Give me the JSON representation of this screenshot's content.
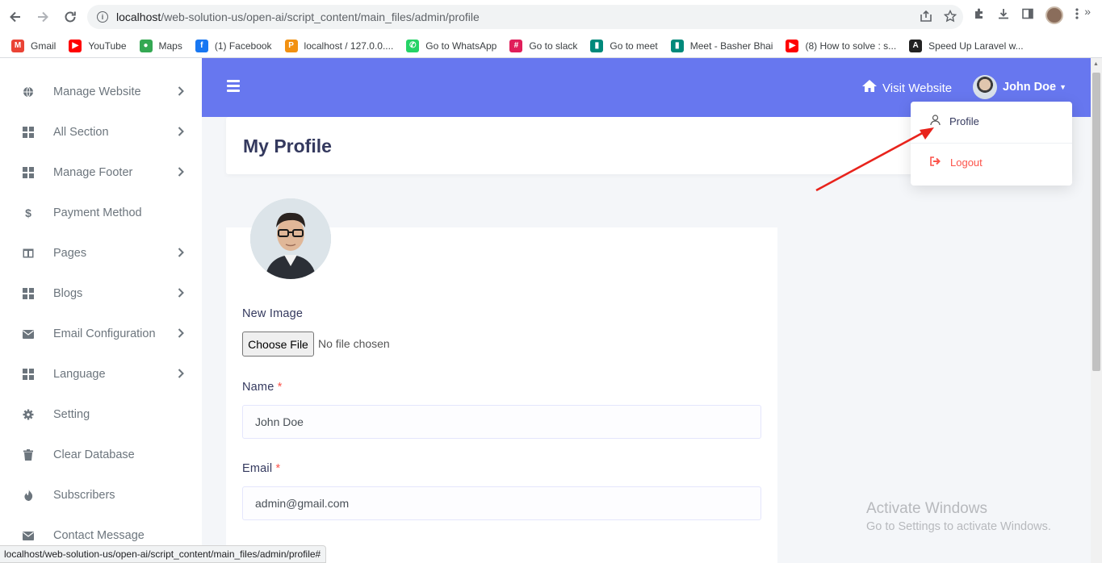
{
  "browser": {
    "url_host": "localhost",
    "url_path": "/web-solution-us/open-ai/script_content/main_files/admin/profile",
    "icons": [
      "back-arrow-icon",
      "forward-arrow-icon",
      "reload-icon",
      "info-icon",
      "share-icon",
      "star-icon",
      "puzzle-icon",
      "download-icon",
      "side-panel-icon",
      "kebab-menu-icon"
    ],
    "bookmarks": [
      {
        "label": "Gmail",
        "icon": "gmail-icon",
        "color": "#ea4335"
      },
      {
        "label": "YouTube",
        "icon": "youtube-icon",
        "color": "#ff0000"
      },
      {
        "label": "Maps",
        "icon": "maps-icon",
        "color": "#34a853"
      },
      {
        "label": "(1) Facebook",
        "icon": "facebook-icon",
        "color": "#1877f2"
      },
      {
        "label": "localhost / 127.0.0....",
        "icon": "phpmyadmin-icon",
        "color": "#f29111"
      },
      {
        "label": "Go to WhatsApp",
        "icon": "whatsapp-icon",
        "color": "#25d366"
      },
      {
        "label": "Go to slack",
        "icon": "slack-icon",
        "color": "#e01e5a"
      },
      {
        "label": "Go to meet",
        "icon": "meet-icon",
        "color": "#00897b"
      },
      {
        "label": "Meet - Basher Bhai",
        "icon": "meet-icon",
        "color": "#00897b"
      },
      {
        "label": "(8) How to solve : s...",
        "icon": "youtube-icon",
        "color": "#ff0000"
      },
      {
        "label": "Speed Up Laravel w...",
        "icon": "laravel-icon",
        "color": "#222222"
      }
    ],
    "status_url": "localhost/web-solution-us/open-ai/script_content/main_files/admin/profile#"
  },
  "sidebar": {
    "items": [
      {
        "label": "Manage Website",
        "icon": "globe-icon",
        "has_submenu": true
      },
      {
        "label": "All Section",
        "icon": "grid-icon",
        "has_submenu": true
      },
      {
        "label": "Manage Footer",
        "icon": "grid-icon",
        "has_submenu": true
      },
      {
        "label": "Payment Method",
        "icon": "dollar-icon",
        "has_submenu": false
      },
      {
        "label": "Pages",
        "icon": "columns-icon",
        "has_submenu": true
      },
      {
        "label": "Blogs",
        "icon": "grid-icon",
        "has_submenu": true
      },
      {
        "label": "Email Configuration",
        "icon": "envelope-icon",
        "has_submenu": true
      },
      {
        "label": "Language",
        "icon": "grid-icon",
        "has_submenu": true
      },
      {
        "label": "Setting",
        "icon": "gear-icon",
        "has_submenu": false
      },
      {
        "label": "Clear Database",
        "icon": "trash-icon",
        "has_submenu": false
      },
      {
        "label": "Subscribers",
        "icon": "fire-icon",
        "has_submenu": false
      },
      {
        "label": "Contact Message",
        "icon": "envelope-icon",
        "has_submenu": false
      }
    ]
  },
  "header": {
    "visit_website": "Visit Website",
    "user_name": "John Doe",
    "accent_color": "#6777ef"
  },
  "dropdown": {
    "profile": "Profile",
    "logout": "Logout",
    "logout_color": "#fc544b"
  },
  "page": {
    "title": "My Profile"
  },
  "form": {
    "new_image_label": "New Image",
    "choose_file": "Choose File",
    "file_status": "No file chosen",
    "name_label": "Name",
    "name_value": "John Doe",
    "email_label": "Email",
    "email_value": "admin@gmail.com",
    "required_mark": "*"
  },
  "watermark": {
    "line1": "Activate Windows",
    "line2": "Go to Settings to activate Windows."
  }
}
